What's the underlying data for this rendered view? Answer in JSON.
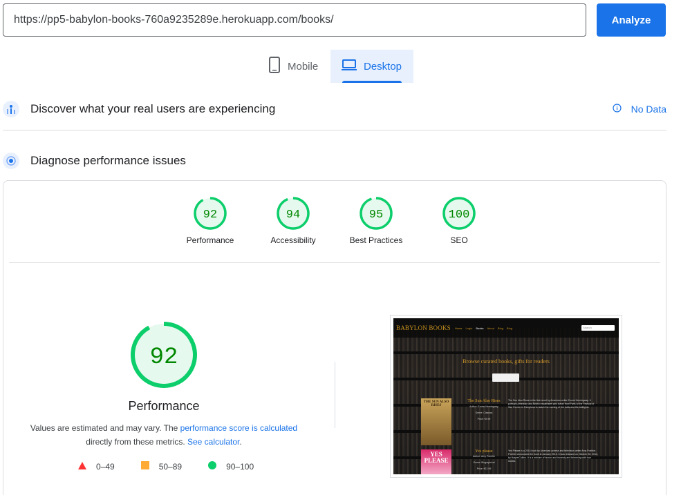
{
  "url_bar": {
    "value": "https://pp5-babylon-books-760a9235289e.herokuapp.com/books/",
    "analyze_label": "Analyze"
  },
  "device_tabs": [
    {
      "label": "Mobile",
      "icon": "phone-icon",
      "selected": false
    },
    {
      "label": "Desktop",
      "icon": "laptop-icon",
      "selected": true
    }
  ],
  "field_data": {
    "title": "Discover what your real users are experiencing",
    "status": "No Data",
    "icon": "users-chart-icon"
  },
  "lab_data": {
    "title": "Diagnose performance issues",
    "icon": "lab-icon"
  },
  "scores": [
    {
      "label": "Performance",
      "value": 92
    },
    {
      "label": "Accessibility",
      "value": 94
    },
    {
      "label": "Best Practices",
      "value": 95
    },
    {
      "label": "SEO",
      "value": 100
    }
  ],
  "main_gauge": {
    "value": 92,
    "label": "Performance",
    "note_prefix": "Values are estimated and may vary. The ",
    "note_link1": "performance score is calculated",
    "note_middle": "directly from these metrics. ",
    "note_link2": "See calculator",
    "note_suffix": "."
  },
  "legend": [
    {
      "range": "0–49",
      "shape": "triangle",
      "color": "#ff3333"
    },
    {
      "range": "50–89",
      "shape": "square",
      "color": "#ffaa33"
    },
    {
      "range": "90–100",
      "shape": "circle",
      "color": "#0cce6b"
    }
  ],
  "colors": {
    "accent": "#1a73e8",
    "pass": "#0cce6b",
    "pass_text": "#008800",
    "pass_fill": "#e6f9ee"
  },
  "screenshot": {
    "brand": "BABYLON BOOKS",
    "nav": [
      "Home",
      "Login",
      "Books",
      "About",
      "Blog",
      "Blog"
    ],
    "search_placeholder": "Search",
    "hero": "Browse curated books, gifts for readers",
    "books": [
      {
        "cover": "THE SUN ALSO RISES",
        "title": "The Sun Also Rises",
        "author": "Author: Ernest Hemingway",
        "genre": "Genre: Classics",
        "price": "Price: €9.99",
        "desc": "The Sun Also Rises is the first novel by American writer Ernest Hemingway. It portrays American and British expatriates who travel from Paris to the Festival of San Fermín in Pamplona to watch the running of the bulls and the bullfights."
      },
      {
        "cover": "YES PLEASE",
        "title": "Yes please",
        "author": "Author: Amy Poehler",
        "genre": "Genre: Biographical",
        "price": "Price: €12.99",
        "desc": "Yes Please is a 2014 book by American actress and television writer Amy Poehler. Poehler announced the book in January 2013. It was released on October 28, 2014, by HarperCollins. It is a mixture of humor and honesty and brimming with true stories."
      }
    ]
  }
}
